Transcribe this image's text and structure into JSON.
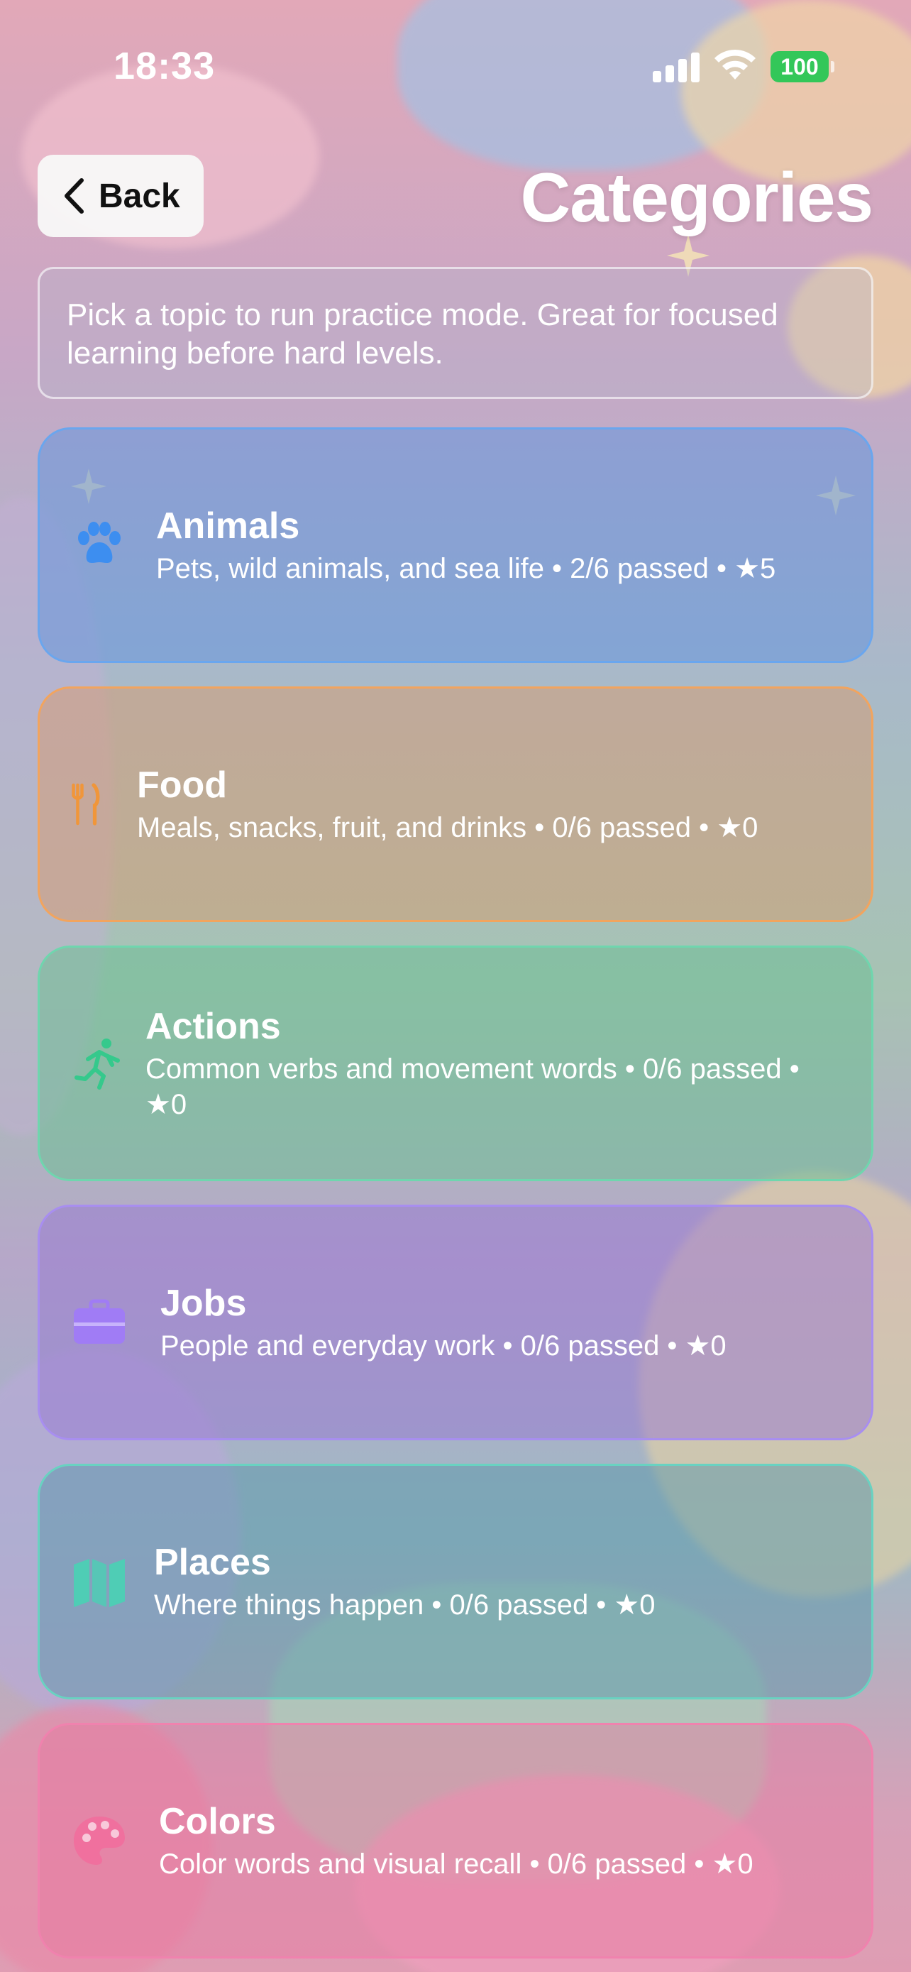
{
  "status_bar": {
    "time": "18:33",
    "battery": "100",
    "battery_color": "#33c759"
  },
  "header": {
    "back_label": "Back",
    "title": "Categories"
  },
  "intro": {
    "text": "Pick a topic to run practice mode. Great for focused learning before hard levels."
  },
  "categories": [
    {
      "title": "Animals",
      "meta": "Pets, wild animals, and sea life • 2/6 passed • ★5",
      "icon": "paw-icon",
      "color": "#3d8ef0"
    },
    {
      "title": "Food",
      "meta": "Meals, snacks, fruit, and drinks • 0/6 passed • ★0",
      "icon": "fork-knife-icon",
      "color": "#f0963a"
    },
    {
      "title": "Actions",
      "meta": "Common verbs and movement words • 0/6 passed • ★0",
      "icon": "running-person-icon",
      "color": "#35c98c"
    },
    {
      "title": "Jobs",
      "meta": "People and everyday work • 0/6 passed • ★0",
      "icon": "briefcase-icon",
      "color": "#a07cf5"
    },
    {
      "title": "Places",
      "meta": "Where things happen • 0/6 passed • ★0",
      "icon": "map-icon",
      "color": "#4fcdb5"
    },
    {
      "title": "Colors",
      "meta": "Color words and visual recall • 0/6 passed • ★0",
      "icon": "palette-icon",
      "color": "#f0709e"
    }
  ]
}
